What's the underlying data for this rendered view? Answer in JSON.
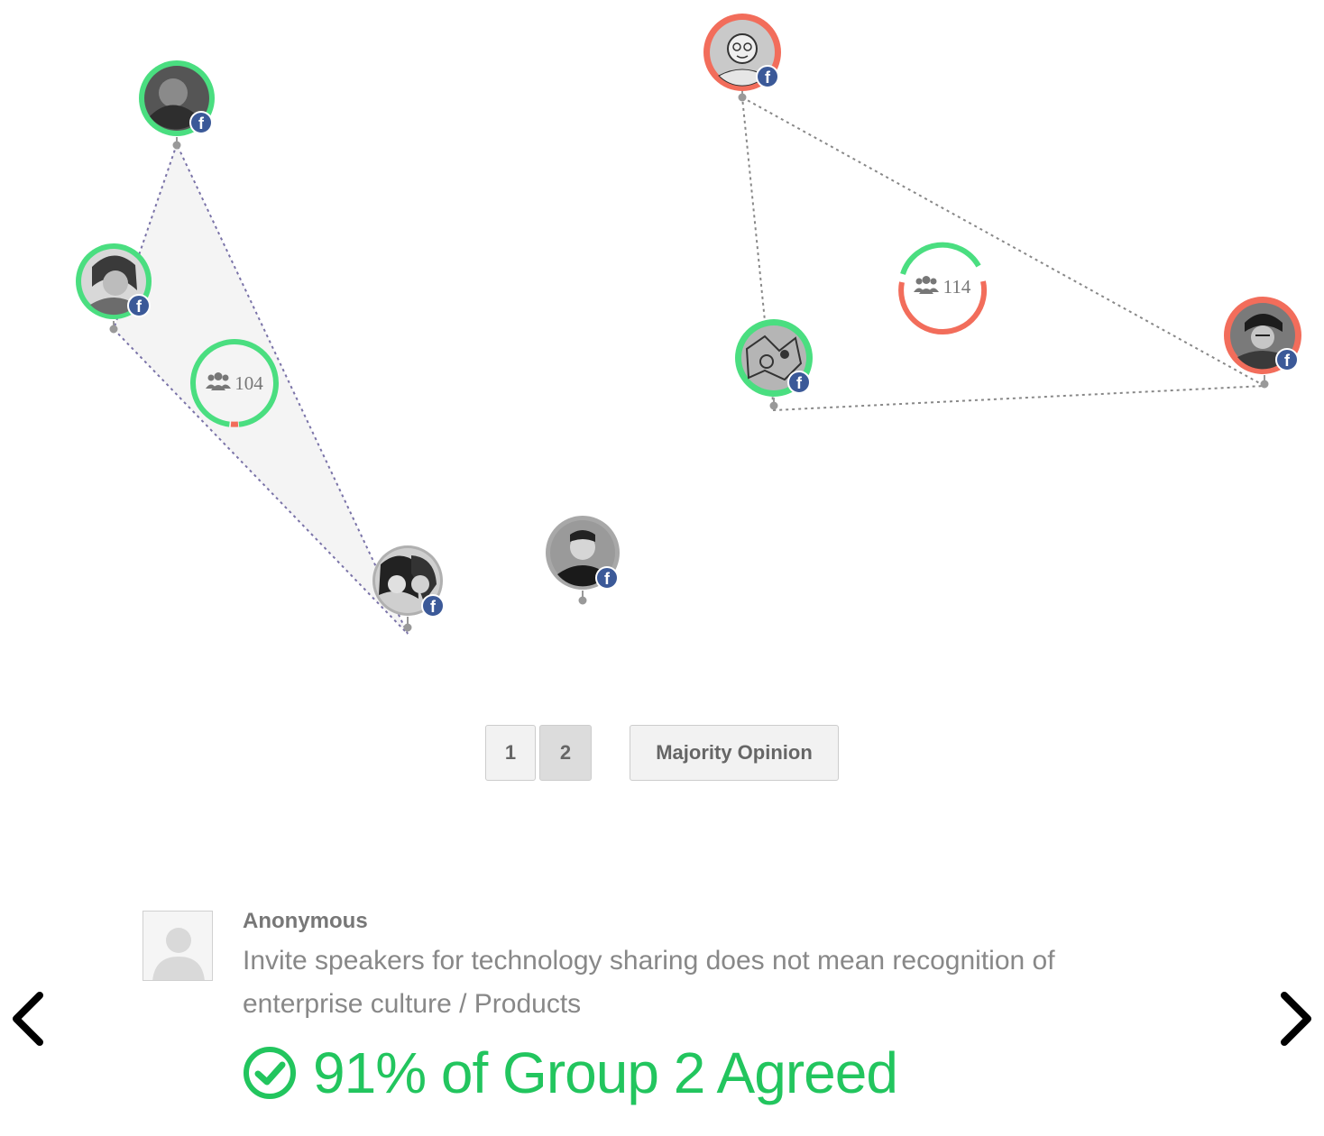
{
  "colors": {
    "agree": "#4ade80",
    "disagree": "#f26d5b",
    "neutral": "#b0b0b0",
    "facebook": "#3b5998",
    "hull_fill": "#f4f4f4",
    "hull_stroke": "#7a73a8",
    "agreed_text": "#22c55e"
  },
  "groups": [
    {
      "id": 1,
      "participant_count": "104",
      "participant_icon": "group-icon",
      "ring": "mostly-agree"
    },
    {
      "id": 2,
      "participant_count": "114",
      "participant_icon": "group-icon",
      "ring": "mostly-disagree"
    }
  ],
  "participants": [
    {
      "group": 1,
      "vote": "agree",
      "badge": "facebook-icon"
    },
    {
      "group": 1,
      "vote": "agree",
      "badge": "facebook-icon"
    },
    {
      "group": 1,
      "vote": "neutral",
      "badge": "facebook-icon"
    },
    {
      "group": 0,
      "vote": "neutral",
      "badge": "facebook-icon"
    },
    {
      "group": 2,
      "vote": "disagree",
      "badge": "facebook-icon"
    },
    {
      "group": 2,
      "vote": "agree",
      "badge": "facebook-icon"
    },
    {
      "group": 2,
      "vote": "disagree",
      "badge": "facebook-icon"
    }
  ],
  "pager": {
    "pages": [
      "1",
      "2"
    ],
    "active_page": "2",
    "majority_label": "Majority Opinion"
  },
  "comment": {
    "author": "Anonymous",
    "text": "Invite speakers for technology sharing does not mean recognition of enterprise culture / Products",
    "agreed_label": "91% of Group 2 Agreed",
    "agreed_icon": "check-circle-icon"
  },
  "nav": {
    "prev_icon": "chevron-left-icon",
    "next_icon": "chevron-right-icon"
  }
}
